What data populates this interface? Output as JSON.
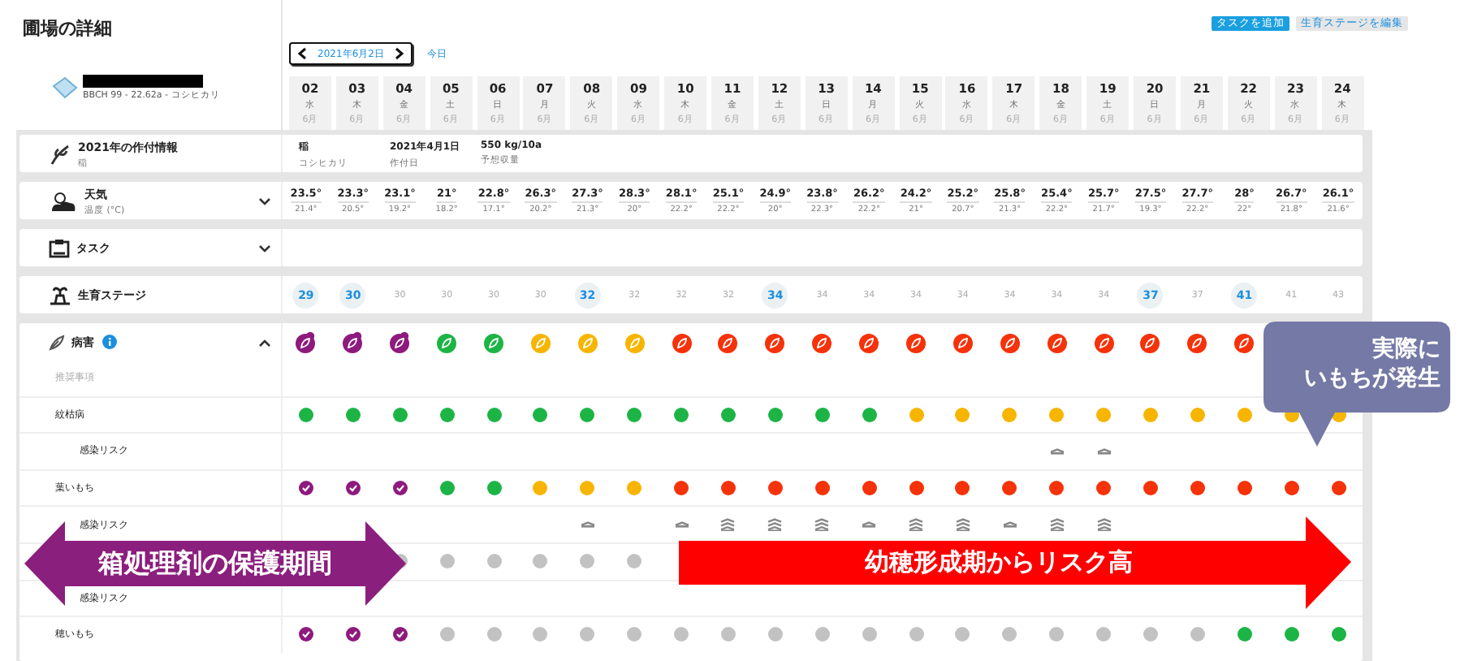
{
  "title": "圃場の詳細",
  "date_nav": {
    "date": "2021年6月2日",
    "today": "今日"
  },
  "buttons": [
    {
      "label": "タスクを追加",
      "kind": "primary"
    },
    {
      "label": "生育ステージを編集",
      "kind": "secondary"
    }
  ],
  "field": {
    "details": "BBCH 99 - 22.62a - コシヒカリ"
  },
  "days": [
    {
      "day": "02",
      "weekday": "水",
      "month": "6月"
    },
    {
      "day": "03",
      "weekday": "木",
      "month": "6月"
    },
    {
      "day": "04",
      "weekday": "金",
      "month": "6月"
    },
    {
      "day": "05",
      "weekday": "土",
      "month": "6月"
    },
    {
      "day": "06",
      "weekday": "日",
      "month": "6月"
    },
    {
      "day": "07",
      "weekday": "月",
      "month": "6月"
    },
    {
      "day": "08",
      "weekday": "火",
      "month": "6月"
    },
    {
      "day": "09",
      "weekday": "水",
      "month": "6月"
    },
    {
      "day": "10",
      "weekday": "木",
      "month": "6月"
    },
    {
      "day": "11",
      "weekday": "金",
      "month": "6月"
    },
    {
      "day": "12",
      "weekday": "土",
      "month": "6月"
    },
    {
      "day": "13",
      "weekday": "日",
      "month": "6月"
    },
    {
      "day": "14",
      "weekday": "月",
      "month": "6月"
    },
    {
      "day": "15",
      "weekday": "火",
      "month": "6月"
    },
    {
      "day": "16",
      "weekday": "水",
      "month": "6月"
    },
    {
      "day": "17",
      "weekday": "木",
      "month": "6月"
    },
    {
      "day": "18",
      "weekday": "金",
      "month": "6月"
    },
    {
      "day": "19",
      "weekday": "土",
      "month": "6月"
    },
    {
      "day": "20",
      "weekday": "日",
      "month": "6月"
    },
    {
      "day": "21",
      "weekday": "月",
      "month": "6月"
    },
    {
      "day": "22",
      "weekday": "火",
      "month": "6月"
    },
    {
      "day": "23",
      "weekday": "水",
      "month": "6月"
    },
    {
      "day": "24",
      "weekday": "木",
      "month": "6月"
    }
  ],
  "crop_info": {
    "title": "2021年の作付情報",
    "subtitle": "稲",
    "items": [
      {
        "value": "稲",
        "label": "コシヒカリ"
      },
      {
        "value": "2021年4月1日",
        "label": "作付日"
      },
      {
        "value": "550 kg/10a",
        "label": "予想収量"
      }
    ]
  },
  "weather": {
    "title": "天気",
    "subtitle": "温度 (°C)",
    "expanded": false,
    "highs": [
      "23.5°",
      "23.3°",
      "23.1°",
      "21°",
      "22.8°",
      "26.3°",
      "27.3°",
      "28.3°",
      "28.1°",
      "25.1°",
      "24.9°",
      "23.8°",
      "26.2°",
      "24.2°",
      "25.2°",
      "25.8°",
      "25.4°",
      "25.7°",
      "27.5°",
      "27.7°",
      "28°",
      "26.7°",
      "26.1°"
    ],
    "lows": [
      "21.4°",
      "20.5°",
      "19.2°",
      "18.2°",
      "17.1°",
      "20.2°",
      "21.3°",
      "20°",
      "22.2°",
      "22.2°",
      "20°",
      "22.3°",
      "22.2°",
      "21°",
      "20.7°",
      "21.3°",
      "22.2°",
      "21.7°",
      "19.3°",
      "22.2°",
      "22°",
      "21.8°",
      "21.6°"
    ]
  },
  "tasks": {
    "title": "タスク",
    "expanded": false
  },
  "growth_stage": {
    "title": "生育ステージ",
    "stages": [
      {
        "value": "29",
        "highlighted": true
      },
      {
        "value": "30",
        "highlighted": true
      },
      {
        "value": "30",
        "highlighted": false
      },
      {
        "value": "30",
        "highlighted": false
      },
      {
        "value": "30",
        "highlighted": false
      },
      {
        "value": "30",
        "highlighted": false
      },
      {
        "value": "32",
        "highlighted": true
      },
      {
        "value": "32",
        "highlighted": false
      },
      {
        "value": "32",
        "highlighted": false
      },
      {
        "value": "32",
        "highlighted": false
      },
      {
        "value": "34",
        "highlighted": true
      },
      {
        "value": "34",
        "highlighted": false
      },
      {
        "value": "34",
        "highlighted": false
      },
      {
        "value": "34",
        "highlighted": false
      },
      {
        "value": "34",
        "highlighted": false
      },
      {
        "value": "34",
        "highlighted": false
      },
      {
        "value": "34",
        "highlighted": false
      },
      {
        "value": "34",
        "highlighted": false
      },
      {
        "value": "37",
        "highlighted": true
      },
      {
        "value": "37",
        "highlighted": false
      },
      {
        "value": "41",
        "highlighted": true
      },
      {
        "value": "41",
        "highlighted": false
      },
      {
        "value": "43",
        "highlighted": false
      }
    ]
  },
  "disease": {
    "title": "病害",
    "expanded": true,
    "summary": [
      {
        "kind": "tagged",
        "color": "#8e1a7e"
      },
      {
        "kind": "tagged",
        "color": "#8e1a7e"
      },
      {
        "kind": "tagged",
        "color": "#8e1a7e"
      },
      {
        "kind": "plain",
        "color": "#1db446"
      },
      {
        "kind": "plain",
        "color": "#1db446"
      },
      {
        "kind": "plain",
        "color": "#f7b500"
      },
      {
        "kind": "plain",
        "color": "#f7b500"
      },
      {
        "kind": "plain",
        "color": "#f7b500"
      },
      {
        "kind": "plain",
        "color": "#f5320a"
      },
      {
        "kind": "plain",
        "color": "#f5320a"
      },
      {
        "kind": "plain",
        "color": "#f5320a"
      },
      {
        "kind": "plain",
        "color": "#f5320a"
      },
      {
        "kind": "plain",
        "color": "#f5320a"
      },
      {
        "kind": "plain",
        "color": "#f5320a"
      },
      {
        "kind": "plain",
        "color": "#f5320a"
      },
      {
        "kind": "plain",
        "color": "#f5320a"
      },
      {
        "kind": "plain",
        "color": "#f5320a"
      },
      {
        "kind": "plain",
        "color": "#f5320a"
      },
      {
        "kind": "plain",
        "color": "#f5320a"
      },
      {
        "kind": "plain",
        "color": "#f5320a"
      },
      {
        "kind": "plain",
        "color": "#f5320a"
      },
      {
        "kind": "none"
      },
      {
        "kind": "none"
      }
    ],
    "recommendation_label": "推奨事項",
    "rows": [
      {
        "kind": "disease",
        "label": "紋枯病",
        "days": [
          {
            "kind": "dot",
            "color": "#1db446"
          },
          {
            "kind": "dot",
            "color": "#1db446"
          },
          {
            "kind": "dot",
            "color": "#1db446"
          },
          {
            "kind": "dot",
            "color": "#1db446"
          },
          {
            "kind": "dot",
            "color": "#1db446"
          },
          {
            "kind": "dot",
            "color": "#1db446"
          },
          {
            "kind": "dot",
            "color": "#1db446"
          },
          {
            "kind": "dot",
            "color": "#1db446"
          },
          {
            "kind": "dot",
            "color": "#1db446"
          },
          {
            "kind": "dot",
            "color": "#1db446"
          },
          {
            "kind": "dot",
            "color": "#1db446"
          },
          {
            "kind": "dot",
            "color": "#1db446"
          },
          {
            "kind": "dot",
            "color": "#1db446"
          },
          {
            "kind": "dot",
            "color": "#f7b500"
          },
          {
            "kind": "dot",
            "color": "#f7b500"
          },
          {
            "kind": "dot",
            "color": "#f7b500"
          },
          {
            "kind": "dot",
            "color": "#f7b500"
          },
          {
            "kind": "dot",
            "color": "#f7b500"
          },
          {
            "kind": "dot",
            "color": "#f7b500"
          },
          {
            "kind": "dot",
            "color": "#f7b500"
          },
          {
            "kind": "dot",
            "color": "#f7b500"
          },
          {
            "kind": "dot",
            "color": "#f7b500"
          },
          {
            "kind": "dot",
            "color": "#f7b500"
          }
        ]
      },
      {
        "kind": "risk",
        "label": "感染リスク",
        "days": [
          {
            "kind": "none"
          },
          {
            "kind": "none"
          },
          {
            "kind": "none"
          },
          {
            "kind": "none"
          },
          {
            "kind": "none"
          },
          {
            "kind": "none"
          },
          {
            "kind": "none"
          },
          {
            "kind": "none"
          },
          {
            "kind": "none"
          },
          {
            "kind": "none"
          },
          {
            "kind": "none"
          },
          {
            "kind": "none"
          },
          {
            "kind": "none"
          },
          {
            "kind": "none"
          },
          {
            "kind": "none"
          },
          {
            "kind": "none"
          },
          {
            "kind": "low"
          },
          {
            "kind": "low"
          },
          {
            "kind": "none"
          },
          {
            "kind": "none"
          },
          {
            "kind": "none"
          },
          {
            "kind": "none"
          },
          {
            "kind": "none"
          }
        ]
      },
      {
        "kind": "disease",
        "label": "葉いもち",
        "days": [
          {
            "kind": "check",
            "color": "#8e1a7e"
          },
          {
            "kind": "check",
            "color": "#8e1a7e"
          },
          {
            "kind": "check",
            "color": "#8e1a7e"
          },
          {
            "kind": "dot",
            "color": "#1db446"
          },
          {
            "kind": "dot",
            "color": "#1db446"
          },
          {
            "kind": "dot",
            "color": "#f7b500"
          },
          {
            "kind": "dot",
            "color": "#f7b500"
          },
          {
            "kind": "dot",
            "color": "#f7b500"
          },
          {
            "kind": "dot",
            "color": "#f5320a"
          },
          {
            "kind": "dot",
            "color": "#f5320a"
          },
          {
            "kind": "dot",
            "color": "#f5320a"
          },
          {
            "kind": "dot",
            "color": "#f5320a"
          },
          {
            "kind": "dot",
            "color": "#f5320a"
          },
          {
            "kind": "dot",
            "color": "#f5320a"
          },
          {
            "kind": "dot",
            "color": "#f5320a"
          },
          {
            "kind": "dot",
            "color": "#f5320a"
          },
          {
            "kind": "dot",
            "color": "#f5320a"
          },
          {
            "kind": "dot",
            "color": "#f5320a"
          },
          {
            "kind": "dot",
            "color": "#f5320a"
          },
          {
            "kind": "dot",
            "color": "#f5320a"
          },
          {
            "kind": "dot",
            "color": "#f5320a"
          },
          {
            "kind": "dot",
            "color": "#f5320a"
          },
          {
            "kind": "dot",
            "color": "#f5320a"
          }
        ]
      },
      {
        "kind": "risk",
        "label": "感染リスク",
        "days": [
          {
            "kind": "none"
          },
          {
            "kind": "none"
          },
          {
            "kind": "none"
          },
          {
            "kind": "none"
          },
          {
            "kind": "none"
          },
          {
            "kind": "none"
          },
          {
            "kind": "low"
          },
          {
            "kind": "none"
          },
          {
            "kind": "low"
          },
          {
            "kind": "high"
          },
          {
            "kind": "high"
          },
          {
            "kind": "high"
          },
          {
            "kind": "low"
          },
          {
            "kind": "high"
          },
          {
            "kind": "high"
          },
          {
            "kind": "low"
          },
          {
            "kind": "high"
          },
          {
            "kind": "high"
          },
          {
            "kind": "none"
          },
          {
            "kind": "none"
          },
          {
            "kind": "none"
          },
          {
            "kind": "none"
          },
          {
            "kind": "none"
          }
        ]
      },
      {
        "kind": "disease",
        "days": [
          {
            "kind": "none"
          },
          {
            "kind": "none"
          },
          {
            "kind": "dot",
            "color": "#c2c2c2"
          },
          {
            "kind": "dot",
            "color": "#c2c2c2"
          },
          {
            "kind": "dot",
            "color": "#c2c2c2"
          },
          {
            "kind": "dot",
            "color": "#c2c2c2"
          },
          {
            "kind": "dot",
            "color": "#c2c2c2"
          },
          {
            "kind": "dot",
            "color": "#c2c2c2"
          },
          {
            "kind": "none"
          },
          {
            "kind": "none"
          },
          {
            "kind": "none"
          },
          {
            "kind": "none"
          },
          {
            "kind": "none"
          },
          {
            "kind": "none"
          },
          {
            "kind": "none"
          },
          {
            "kind": "none"
          },
          {
            "kind": "none"
          },
          {
            "kind": "none"
          },
          {
            "kind": "none"
          },
          {
            "kind": "none"
          },
          {
            "kind": "none"
          },
          {
            "kind": "none"
          },
          {
            "kind": "none"
          }
        ]
      },
      {
        "kind": "risk",
        "label": "感染リスク",
        "days": [
          {
            "kind": "none"
          }
        ]
      },
      {
        "kind": "disease",
        "label": "穂いもち",
        "days": [
          {
            "kind": "check",
            "color": "#8e1a7e"
          },
          {
            "kind": "check",
            "color": "#8e1a7e"
          },
          {
            "kind": "check",
            "color": "#8e1a7e"
          },
          {
            "kind": "dot",
            "color": "#c2c2c2"
          },
          {
            "kind": "dot",
            "color": "#c2c2c2"
          },
          {
            "kind": "dot",
            "color": "#c2c2c2"
          },
          {
            "kind": "dot",
            "color": "#c2c2c2"
          },
          {
            "kind": "dot",
            "color": "#c2c2c2"
          },
          {
            "kind": "dot",
            "color": "#c2c2c2"
          },
          {
            "kind": "dot",
            "color": "#c2c2c2"
          },
          {
            "kind": "dot",
            "color": "#c2c2c2"
          },
          {
            "kind": "dot",
            "color": "#c2c2c2"
          },
          {
            "kind": "dot",
            "color": "#c2c2c2"
          },
          {
            "kind": "dot",
            "color": "#c2c2c2"
          },
          {
            "kind": "dot",
            "color": "#c2c2c2"
          },
          {
            "kind": "dot",
            "color": "#c2c2c2"
          },
          {
            "kind": "dot",
            "color": "#c2c2c2"
          },
          {
            "kind": "dot",
            "color": "#c2c2c2"
          },
          {
            "kind": "dot",
            "color": "#c2c2c2"
          },
          {
            "kind": "dot",
            "color": "#c2c2c2"
          },
          {
            "kind": "dot",
            "color": "#1db446"
          },
          {
            "kind": "dot",
            "color": "#1db446"
          },
          {
            "kind": "dot",
            "color": "#1db446"
          }
        ]
      }
    ]
  },
  "annotations": [
    {
      "kind": "double_arrow",
      "lines": [
        "箱処理剤の保護期間"
      ]
    },
    {
      "kind": "arrow",
      "lines": [
        "幼穂形成期からリスク高"
      ]
    },
    {
      "kind": "callout",
      "lines": [
        "実際に",
        "いもちが発生"
      ]
    }
  ]
}
